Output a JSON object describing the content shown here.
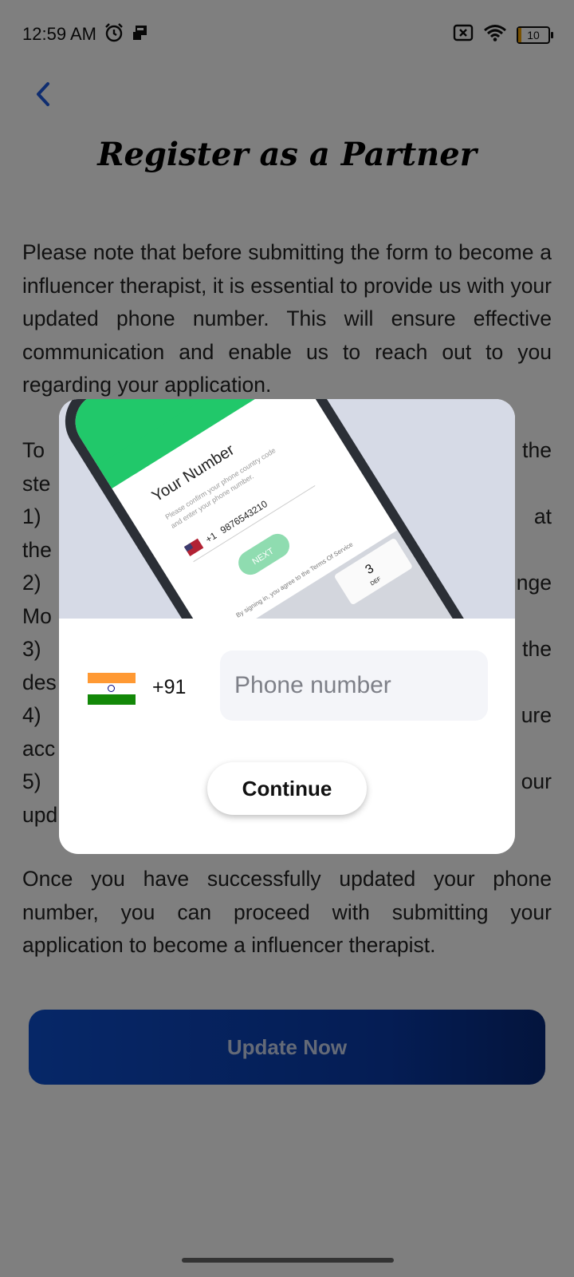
{
  "status_bar": {
    "time": "12:59 AM",
    "battery_level": "10",
    "icons": [
      "alarm-icon",
      "notification-icon",
      "no-sim-icon",
      "wifi-icon",
      "battery-icon"
    ]
  },
  "header": {
    "back_icon": "chevron-left-icon",
    "title": "Register as a Partner"
  },
  "content": {
    "paragraph_1": "Please note that before submitting the form to become a influencer therapist, it is essential to provide us with your updated phone number. This will ensure effective communication and enable us to reach out to you regarding your application.",
    "paragraph_2_lines": [
      "To the",
      "ste",
      "1) at",
      "the",
      "2) nge",
      "Mo",
      "3) the",
      "des",
      "4) ure",
      "acc",
      "5) our",
      "upd"
    ],
    "paragraph_3": "Once you have successfully updated your phone number, you can proceed with submitting your application to become a influencer therapist.",
    "update_button_label": "Update Now"
  },
  "modal": {
    "illustration": {
      "heading": "Your Number",
      "subtext_line1": "Please confirm your phone country code",
      "subtext_line2": "and enter your phone number.",
      "country_code": "+1",
      "number": "9876543210",
      "next_label": "NEXT",
      "terms_text": "By signing in, you agree to the Terms Of Service",
      "key_number": "3",
      "key_letters": "DEF"
    },
    "country_code": "+91",
    "phone_placeholder": "Phone number",
    "continue_label": "Continue"
  },
  "colors": {
    "primary_blue": "#0d4fcf",
    "overlay": "rgba(0,0,0,0.5)",
    "illustration_green": "#2ecc71"
  }
}
